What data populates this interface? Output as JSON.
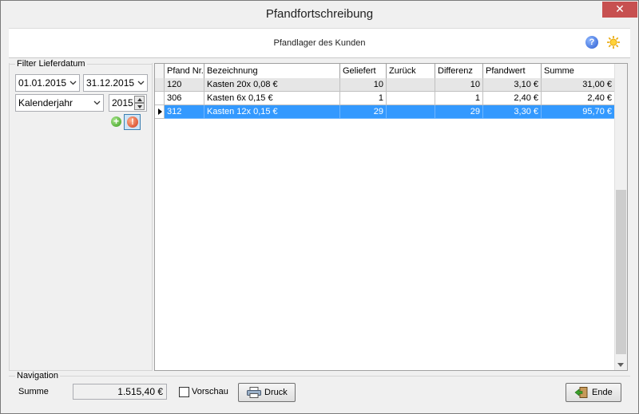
{
  "window": {
    "title": "Pfandfortschreibung"
  },
  "header": {
    "title": "Pfandlager des Kunden",
    "help_icon": "help-icon",
    "options_icon": "sun-icon"
  },
  "filter": {
    "legend": "Filter Lieferdatum",
    "date_from": "01.01.2015",
    "date_to": "31.12.2015",
    "period": "Kalenderjahr",
    "year": "2015"
  },
  "grid": {
    "columns": [
      "Pfand Nr.",
      "Bezeichnung",
      "Geliefert",
      "Zurück",
      "Differenz",
      "Pfandwert",
      "Summe"
    ],
    "rows": [
      {
        "nr": "120",
        "bez": "Kasten 20x 0,08 €",
        "geliefert": "10",
        "zurueck": "",
        "differenz": "10",
        "pfandwert": "3,10 €",
        "summe": "31,00 €"
      },
      {
        "nr": "306",
        "bez": "Kasten 6x 0,15 €",
        "geliefert": "1",
        "zurueck": "",
        "differenz": "1",
        "pfandwert": "2,40 €",
        "summe": "2,40 €"
      },
      {
        "nr": "312",
        "bez": "Kasten 12x 0,15 €",
        "geliefert": "29",
        "zurueck": "",
        "differenz": "29",
        "pfandwert": "3,30 €",
        "summe": "95,70 €"
      }
    ],
    "selected_color": "#3399ff"
  },
  "navigation": {
    "legend": "Navigation",
    "summe_label": "Summe",
    "summe_value": "1.515,40 €",
    "vorschau_label": "Vorschau",
    "druck_label": "Druck",
    "ende_label": "Ende"
  }
}
